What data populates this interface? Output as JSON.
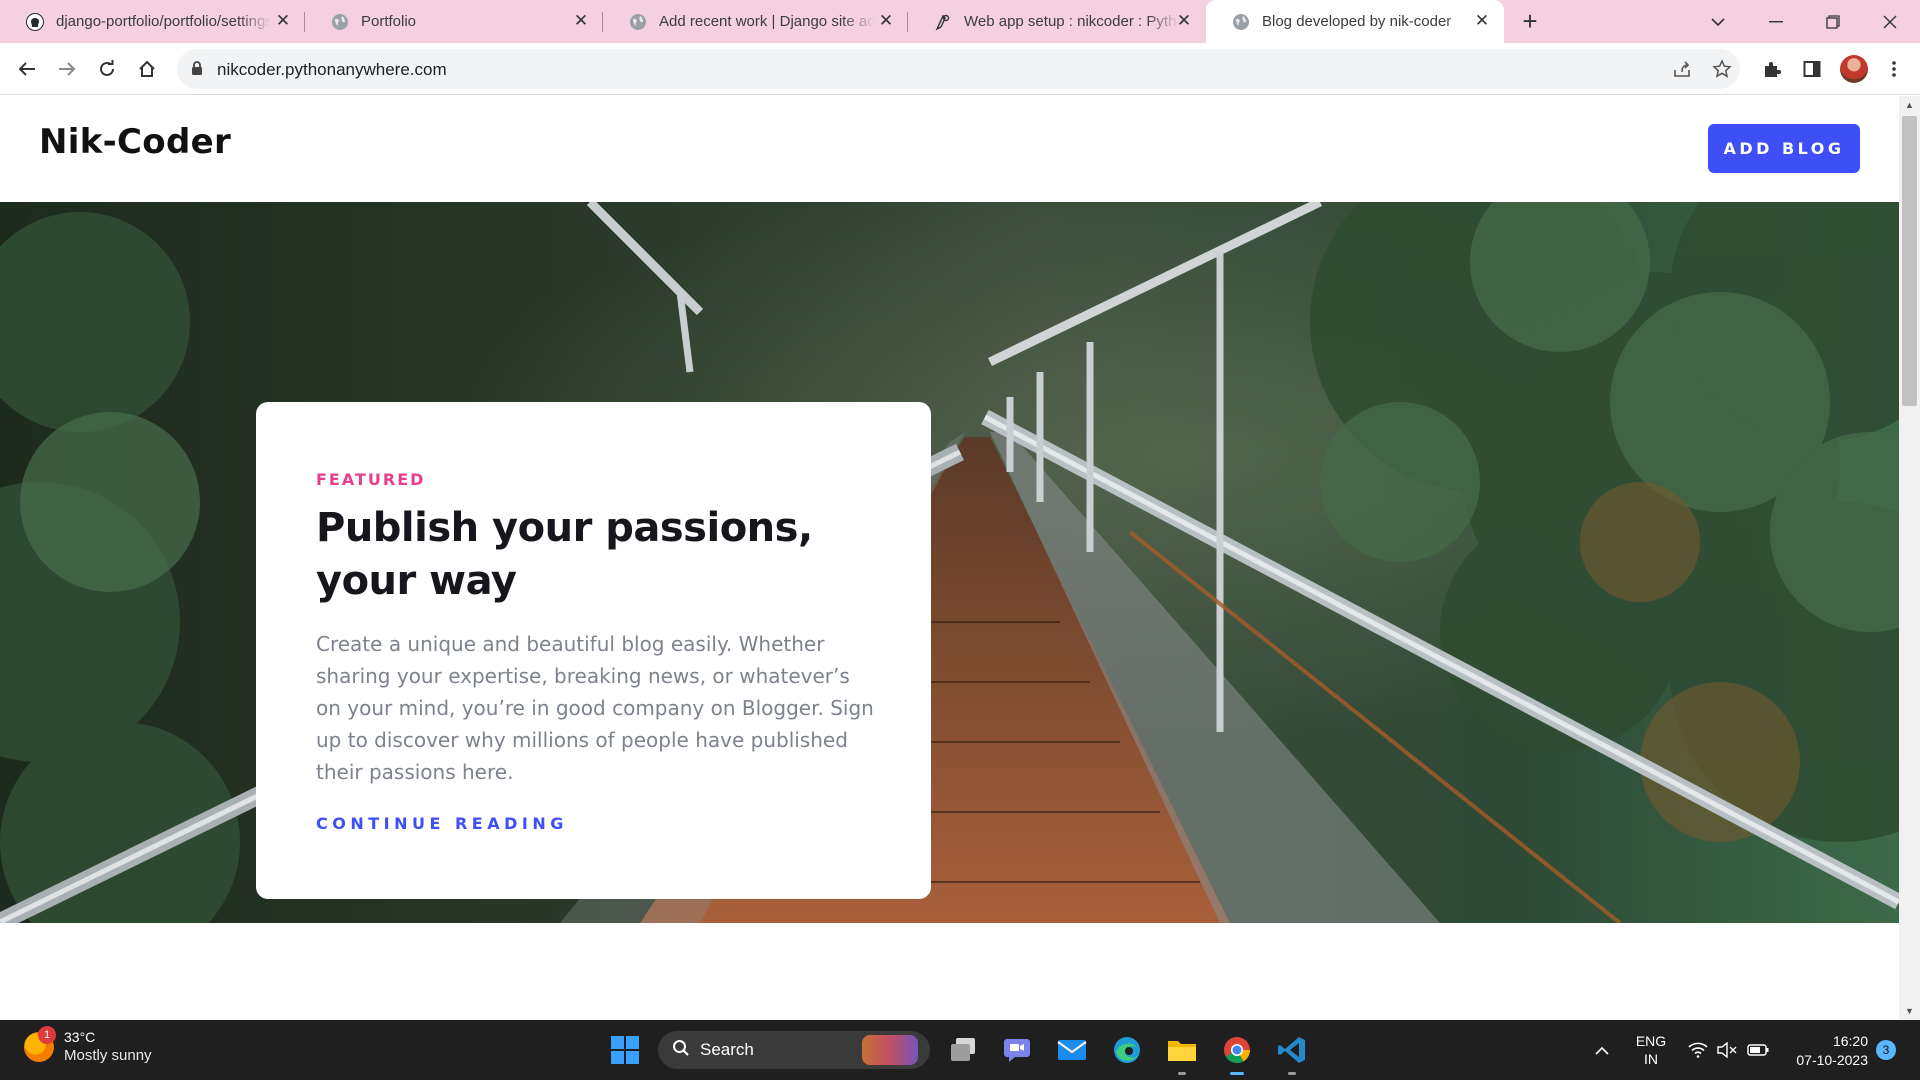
{
  "browser": {
    "tabs": [
      {
        "title": "django-portfolio/portfolio/settings",
        "favicon": "github-icon",
        "active": false
      },
      {
        "title": "Portfolio",
        "favicon": "globe-icon",
        "active": false
      },
      {
        "title": "Add recent work | Django site admin",
        "favicon": "globe-icon",
        "active": false
      },
      {
        "title": "Web app setup : nikcoder : PythonAnywhere",
        "favicon": "python-icon",
        "active": false
      },
      {
        "title": "Blog developed by nik-coder",
        "favicon": "globe-icon",
        "active": true
      }
    ],
    "new_tab_symbol": "+",
    "address": "nikcoder.pythonanywhere.com",
    "tab_strip_color": "#f4d0e0"
  },
  "site": {
    "title": "Nik-Coder",
    "add_blog_label": "ADD BLOG",
    "accent_color": "#3d4ff5"
  },
  "hero": {
    "eyebrow": "FEATURED",
    "headline": "Publish your passions, your way",
    "body": "Create a unique and beautiful blog easily. Whether sharing your expertise, breaking news, or whatever’s on your mind, you’re in good company on Blogger. Sign up to discover why millions of people have published their passions here.",
    "cta": "CONTINUE READING",
    "eyebrow_color": "#e83e8c"
  },
  "taskbar": {
    "weather_badge": "1",
    "temperature": "33°C",
    "condition": "Mostly sunny",
    "search_label": "Search",
    "lang_primary": "ENG",
    "lang_secondary": "IN",
    "time": "16:20",
    "date": "07-10-2023",
    "notification_count": "3"
  }
}
